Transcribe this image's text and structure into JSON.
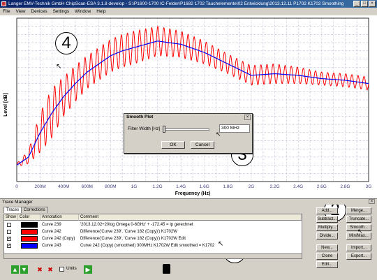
{
  "titlebar": {
    "title": "Langer EMV-Technik GmbH ChipScan-ESA 3.1.8 develop  -  S:\\P1600-1700 IC-Felder\\P1682 1702 Tauchelemente\\02 Entwicklung\\2013.12.11 P1702 K1702 Smoothing"
  },
  "menu": [
    "File",
    "View",
    "Devices",
    "Settings",
    "Window",
    "Help"
  ],
  "plot": {
    "ylabel": "Level [dB]",
    "xlabel": "Frequency (Hz)",
    "xticks": [
      "0",
      "200M",
      "400M",
      "600M",
      "800M",
      "1G",
      "1.2G",
      "1.4G",
      "1.6G",
      "1.8G",
      "2G",
      "2.2G",
      "2.4G",
      "2.6G",
      "2.8G",
      "3G"
    ],
    "colors": {
      "raw": "#ff0000",
      "smoothed": "#0000ff",
      "grid": "#a8a8c8"
    }
  },
  "callouts": [
    "4",
    "3",
    "2",
    "1"
  ],
  "dialog": {
    "title": "Smooth Plot",
    "close": "×",
    "filter_label": "Filter Width [Hz]",
    "filter_value": "300 MHz",
    "ok": "OK",
    "cancel": "Cancel"
  },
  "trace_manager": {
    "title": "Trace Manager",
    "tabs": [
      "Traces",
      "Corrections"
    ],
    "columns": [
      "Show",
      "Color",
      "Annotation",
      "Comment"
    ],
    "rows": [
      {
        "show": "",
        "color": "#000000",
        "annotation": "Curve 239",
        "comment": "'2013.12.02+20log Omega 0-6GHz' + -172.45 = Ip gerechnet"
      },
      {
        "show": "",
        "color": "#ff0000",
        "annotation": "Curve 242",
        "comment": "Difference('Curve 239', 'Curve 182 (Copy)')   K1702W"
      },
      {
        "show": "✓",
        "color": "#ff0000",
        "annotation": "Curve 242 (Copy)",
        "comment": "Difference('Curve 239', 'Curve 182 (Copy)')   K1702W  Edit"
      },
      {
        "show": "✓",
        "color": "#0000ff",
        "annotation": "Curve 243",
        "comment": "Curve 242 (Copy) (smoothed) 300MHz   K1702W  Edit smoothed = K1702"
      }
    ],
    "buttons_mid": [
      "Add...",
      "Subtract...",
      "Multiply...",
      "Divide...",
      "New...",
      "Clone",
      "Edit..."
    ],
    "buttons_right": [
      "Merge...",
      "Truncate...",
      "Smooth...",
      "Min/Max...",
      "Import...",
      "Export..."
    ],
    "units_label": "Units",
    "toolbar_icons": [
      "arrow-up-icon",
      "arrow-down-icon",
      "delete-icon",
      "delete-all-icon",
      "arrow-right-icon",
      "trash-icon"
    ]
  },
  "chart_data": {
    "type": "line",
    "xlabel": "Frequency (Hz)",
    "ylabel": "Level [dB]",
    "xlim": [
      0,
      3000000000
    ],
    "series": [
      {
        "name": "Curve 242 (Copy)",
        "color": "#ff0000",
        "x": [
          0,
          100000000,
          200000000,
          300000000,
          400000000,
          500000000,
          600000000,
          700000000,
          800000000,
          900000000,
          1000000000,
          1200000000,
          1400000000,
          1600000000,
          1800000000,
          2000000000,
          2200000000,
          2400000000,
          2600000000,
          2800000000,
          3000000000
        ],
        "y": [
          0.1,
          0.15,
          0.3,
          0.42,
          0.52,
          0.6,
          0.67,
          0.72,
          0.77,
          0.8,
          0.82,
          0.86,
          0.84,
          0.79,
          0.72,
          0.65,
          0.66,
          0.65,
          0.63,
          0.62,
          0.6
        ],
        "ripple": [
          0.01,
          0.04,
          0.12,
          0.15,
          0.12,
          0.11,
          0.1,
          0.1,
          0.1,
          0.1,
          0.1,
          0.09,
          0.08,
          0.07,
          0.06,
          0.06,
          0.06,
          0.05,
          0.04,
          0.04,
          0.04
        ]
      },
      {
        "name": "Curve 243",
        "color": "#0000ff",
        "x": [
          0,
          100000000,
          200000000,
          300000000,
          400000000,
          500000000,
          600000000,
          700000000,
          800000000,
          900000000,
          1000000000,
          1200000000,
          1400000000,
          1600000000,
          1800000000,
          2000000000,
          2200000000,
          2400000000,
          2600000000,
          2800000000,
          3000000000
        ],
        "y": [
          0.1,
          0.15,
          0.3,
          0.42,
          0.52,
          0.6,
          0.67,
          0.72,
          0.77,
          0.8,
          0.82,
          0.86,
          0.84,
          0.79,
          0.72,
          0.65,
          0.66,
          0.65,
          0.63,
          0.62,
          0.6
        ]
      }
    ]
  }
}
